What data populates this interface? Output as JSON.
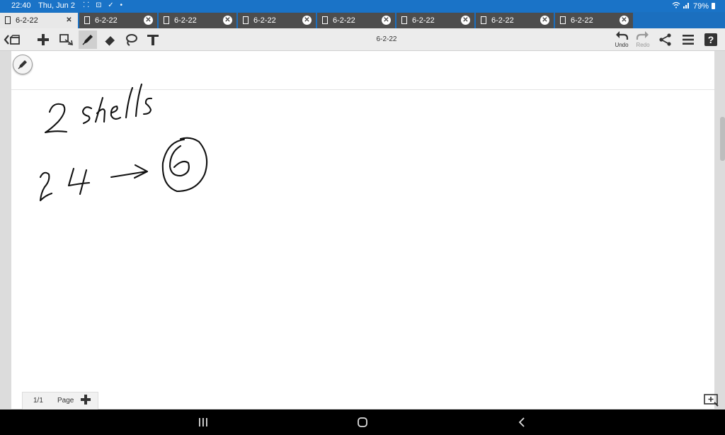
{
  "status_bar": {
    "time": "22:40",
    "date": "Thu, Jun 2",
    "battery": "79%"
  },
  "tabs": [
    {
      "label": "6-2-22",
      "active": true
    },
    {
      "label": "6-2-22",
      "active": false
    },
    {
      "label": "6-2-22",
      "active": false
    },
    {
      "label": "6-2-22",
      "active": false
    },
    {
      "label": "6-2-22",
      "active": false
    },
    {
      "label": "6-2-22",
      "active": false
    },
    {
      "label": "6-2-22",
      "active": false
    },
    {
      "label": "6-2-22",
      "active": false
    }
  ],
  "toolbar": {
    "document_title": "6-2-22",
    "undo_label": "Undo",
    "redo_label": "Redo",
    "selected_tool": "pen",
    "icons": [
      "back-icon",
      "add-icon",
      "image-icon",
      "pen-icon",
      "eraser-icon",
      "lasso-icon",
      "text-icon",
      "undo-icon",
      "redo-icon",
      "share-icon",
      "menu-icon",
      "help-icon"
    ]
  },
  "notes": {
    "handwriting": [
      "2 shells",
      "2 4 →",
      "6"
    ]
  },
  "pager": {
    "page_number": "1/1",
    "page_label": "Page"
  },
  "colors": {
    "status_bar": "#1a73c7",
    "tab_bar": "#1b6fbf",
    "tab_inactive": "#4d4d4d",
    "toolbar": "#ececec",
    "ink": "#111111"
  }
}
